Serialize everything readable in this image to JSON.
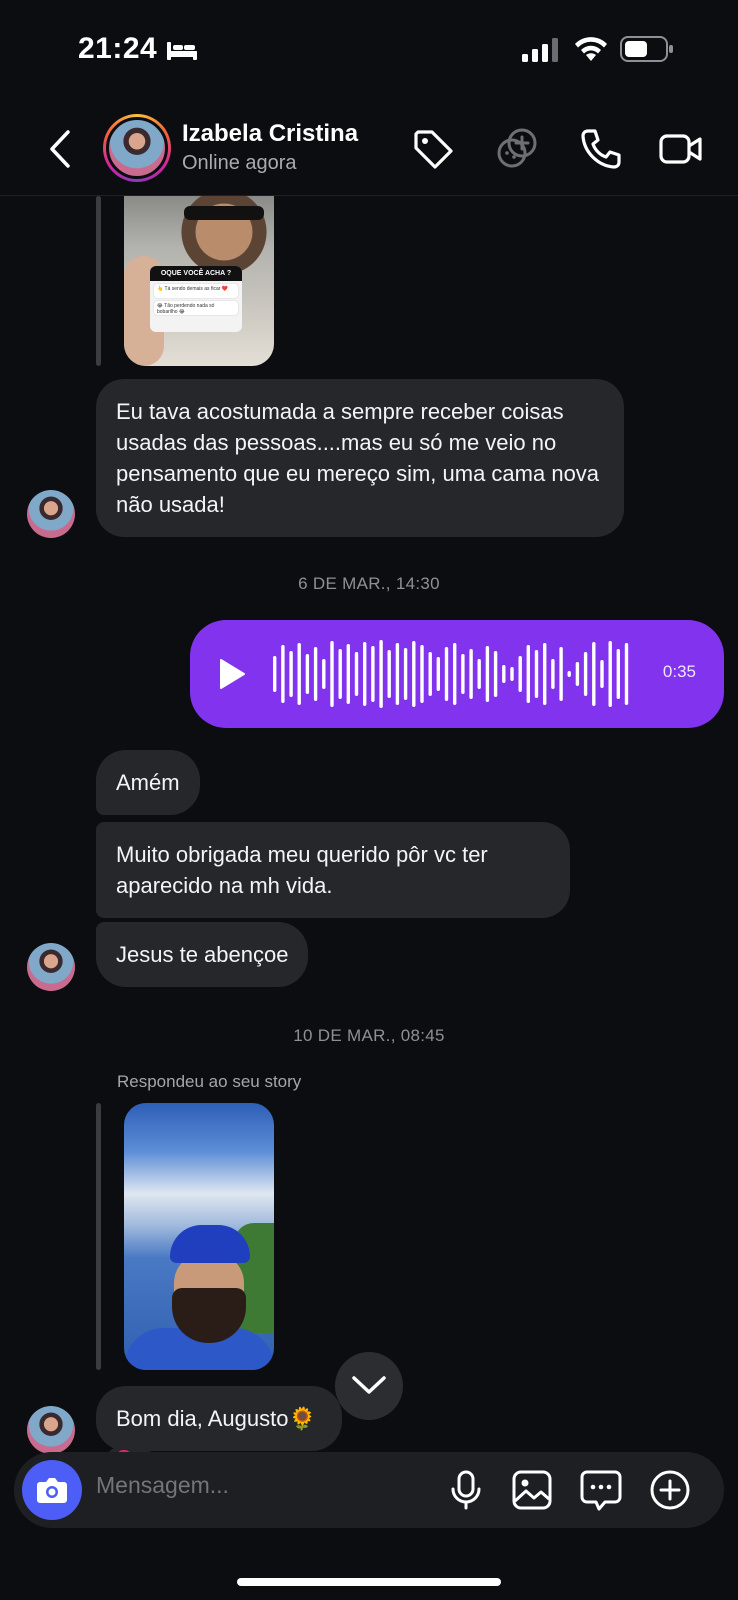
{
  "status_bar": {
    "time": "21:24",
    "icons": [
      "bed-icon",
      "signal-icon",
      "wifi-icon",
      "battery-icon"
    ]
  },
  "header": {
    "contact_name": "Izabela Cristina",
    "contact_status": "Online agora",
    "icons": [
      "back-icon",
      "tag-icon",
      "effects-icon",
      "phone-icon",
      "video-icon"
    ]
  },
  "story_poll": {
    "question": "OQUE VOCÊ ACHA ?",
    "options": [
      "👆 Tá sendo demais as ficar ❤️",
      "😂 Tão perdendo nada só bobarilho 😂"
    ]
  },
  "messages": {
    "msg1": "Eu tava acostumada a sempre receber coisas usadas das pessoas....mas eu só me veio no pensamento que eu mereço sim, uma cama nova não usada!",
    "date1": "6 DE MAR., 14:30",
    "voice_duration": "0:35",
    "amem": "Amém",
    "muito": "Muito obrigada meu querido pôr vc ter aparecido na mh vida.",
    "jesus": "Jesus te abençoe",
    "date2": "10 DE MAR., 08:45",
    "replied_label": "Respondeu ao seu story",
    "bom_dia": "Bom dia, Augusto🌻"
  },
  "composer": {
    "placeholder": "Mensagem..."
  },
  "colors": {
    "background": "#0c0d10",
    "incoming_bubble": "#26272b",
    "outgoing_voice": "#8233ee",
    "camera_button": "#4c5ef5"
  }
}
